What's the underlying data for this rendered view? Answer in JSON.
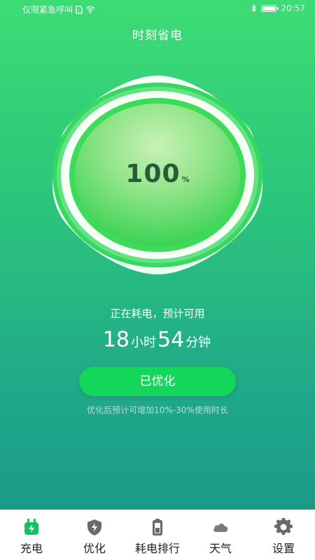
{
  "status_bar": {
    "carrier": "仅限紧急呼叫",
    "time": "20:57"
  },
  "page_title": "时刻省电",
  "battery": {
    "level": 100,
    "unit": "%"
  },
  "status_text": "正在耗电，预计可用",
  "remaining": {
    "hours": "18",
    "hours_unit": "小时",
    "minutes": "54",
    "minutes_unit": "分钟"
  },
  "optimize_button": "已优化",
  "hint": "优化后预计可增加10%-30%使用时长",
  "colors": {
    "primary_green": "#14d65a",
    "gauge_inner": "#3ddb58",
    "bg_top": "#3ddc75",
    "bg_bottom": "#199486"
  },
  "tabs": [
    {
      "label": "充电",
      "icon": "charge-icon",
      "active": true
    },
    {
      "label": "优化",
      "icon": "shield-bolt-icon",
      "active": false
    },
    {
      "label": "耗电排行",
      "icon": "battery-rank-icon",
      "active": false
    },
    {
      "label": "天气",
      "icon": "cloud-icon",
      "active": false
    },
    {
      "label": "设置",
      "icon": "gear-icon",
      "active": false
    }
  ]
}
